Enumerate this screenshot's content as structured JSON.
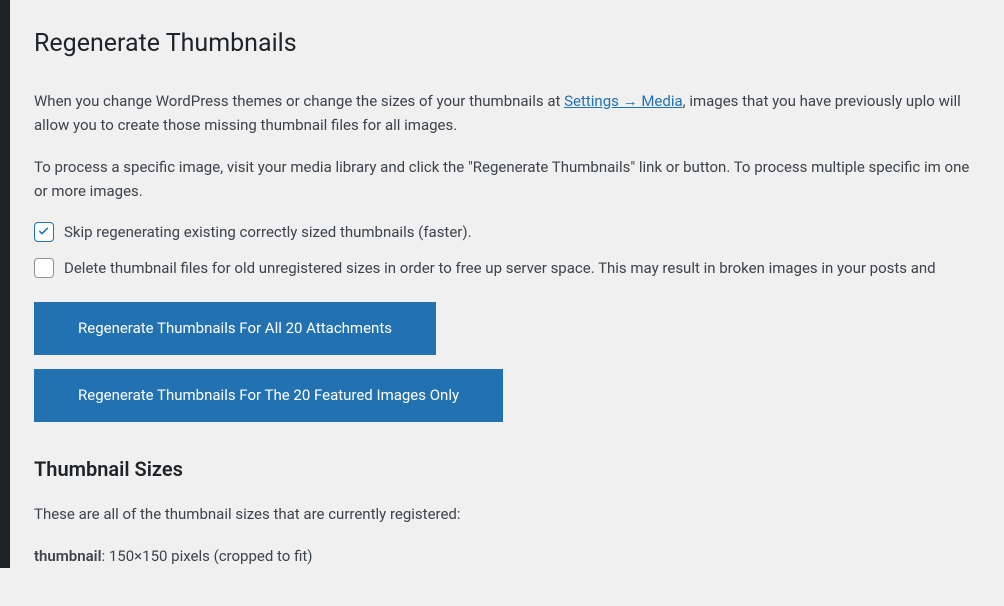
{
  "page": {
    "title": "Regenerate Thumbnails"
  },
  "intro": {
    "para1_a": "When you change WordPress themes or change the sizes of your thumbnails at ",
    "link_label": "Settings → Media",
    "para1_b": ", images that you have previously uplo",
    "para1_c": "will allow you to create those missing thumbnail files for all images.",
    "para2": "To process a specific image, visit your media library and click the \"Regenerate Thumbnails\" link or button. To process multiple specific im one or more images."
  },
  "options": {
    "skip_existing": {
      "checked": true,
      "label": "Skip regenerating existing correctly sized thumbnails (faster)."
    },
    "delete_old": {
      "checked": false,
      "label": "Delete thumbnail files for old unregistered sizes in order to free up server space. This may result in broken images in your posts and"
    }
  },
  "buttons": {
    "regenerate_all": "Regenerate Thumbnails For All 20 Attachments",
    "regenerate_featured": "Regenerate Thumbnails For The 20 Featured Images Only"
  },
  "sizes_section": {
    "heading": "Thumbnail Sizes",
    "description": "These are all of the thumbnail sizes that are currently registered:",
    "items": [
      {
        "name": "thumbnail",
        "detail": ": 150×150 pixels (cropped to fit)"
      }
    ]
  }
}
